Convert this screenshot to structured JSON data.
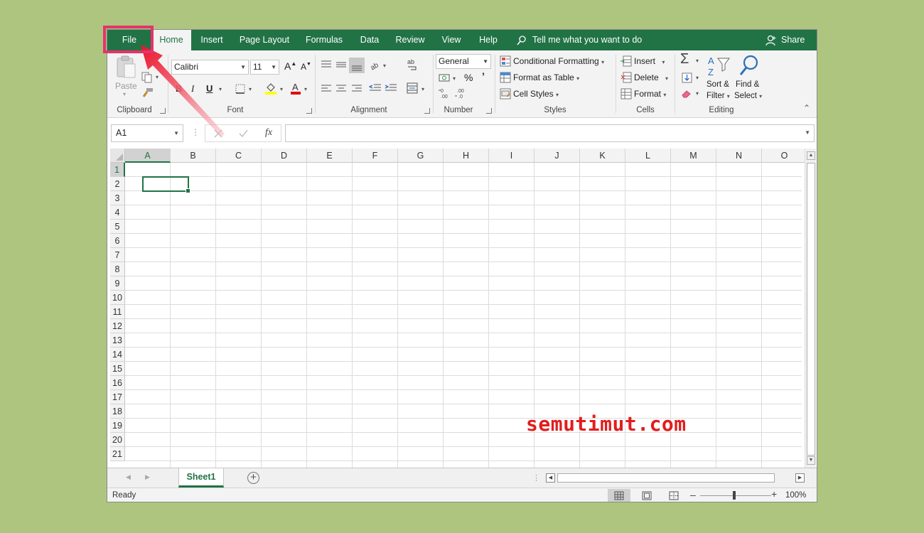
{
  "tabs": {
    "file": "File",
    "home": "Home",
    "insert": "Insert",
    "page_layout": "Page Layout",
    "formulas": "Formulas",
    "data": "Data",
    "review": "Review",
    "view": "View",
    "help": "Help",
    "tell_me": "Tell me what you want to do",
    "share": "Share"
  },
  "ribbon": {
    "clipboard": {
      "paste": "Paste",
      "label": "Clipboard"
    },
    "font": {
      "name": "Calibri",
      "size": "11",
      "bold": "B",
      "italic": "I",
      "underline": "U",
      "label": "Font"
    },
    "alignment": {
      "label": "Alignment"
    },
    "number": {
      "format": "General",
      "percent": "%",
      "comma": "’",
      "label": "Number"
    },
    "styles": {
      "conditional": "Conditional Formatting",
      "format_table": "Format as Table",
      "cell_styles": "Cell Styles",
      "label": "Styles"
    },
    "cells": {
      "insert": "Insert",
      "delete": "Delete",
      "format": "Format",
      "label": "Cells"
    },
    "editing": {
      "sort_line1": "Sort &",
      "sort_line2": "Filter",
      "find_line1": "Find &",
      "find_line2": "Select",
      "label": "Editing"
    }
  },
  "formula_bar": {
    "name_box": "A1",
    "fx": "fx",
    "value": ""
  },
  "grid": {
    "columns": [
      "A",
      "B",
      "C",
      "D",
      "E",
      "F",
      "G",
      "H",
      "I",
      "J",
      "K",
      "L",
      "M",
      "N",
      "O"
    ],
    "rows": [
      "1",
      "2",
      "3",
      "4",
      "5",
      "6",
      "7",
      "8",
      "9",
      "10",
      "11",
      "12",
      "13",
      "14",
      "15",
      "16",
      "17",
      "18",
      "19",
      "20",
      "21"
    ],
    "selected_cell": "A1"
  },
  "sheets": {
    "tabs": [
      "Sheet1"
    ],
    "active": "Sheet1"
  },
  "status": {
    "text": "Ready",
    "zoom": "100%"
  },
  "watermark": "semutimut.com",
  "colors": {
    "accent": "#217346",
    "highlight": "#e5336b",
    "watermark": "#e21d1d",
    "background": "#adc57f"
  }
}
